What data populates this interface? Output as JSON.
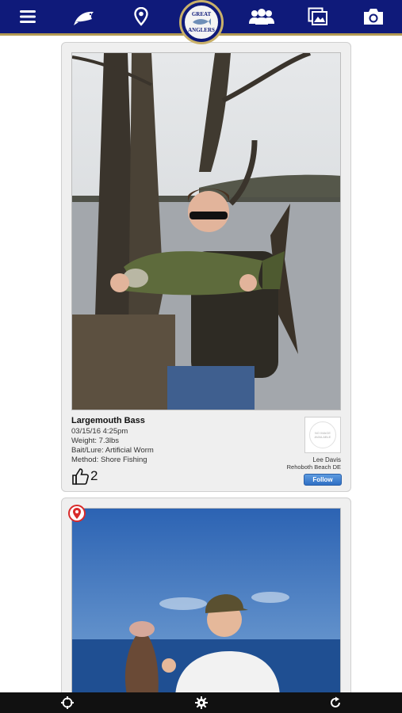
{
  "header": {
    "logo_text_top": "GREAT",
    "logo_text_bottom": "ANGLERS",
    "icons": [
      "menu-icon",
      "fish-icon",
      "location-pin-icon",
      "logo",
      "group-icon",
      "photo-gallery-icon",
      "camera-icon"
    ]
  },
  "posts": [
    {
      "species": "Largemouth Bass",
      "date": "03/15/16 4:25pm",
      "weight": "Weight: 7.3lbs",
      "bait": "Bait/Lure: Artificial Worm",
      "method": "Method: Shore Fishing",
      "likes": "2",
      "avatar_placeholder": "NO IMAGE AVAILABLE",
      "user_name": "Lee Davis",
      "user_location": "Rehoboth Beach DE",
      "follow_label": "Follow"
    }
  ],
  "footer": {
    "icons": [
      "recenter-icon",
      "settings-gear-icon",
      "refresh-icon"
    ]
  },
  "colors": {
    "header_bg": "#0f1a7a",
    "header_accent": "#b39a52",
    "follow_button": "#3a7bd5",
    "footer_bg": "#111111"
  }
}
